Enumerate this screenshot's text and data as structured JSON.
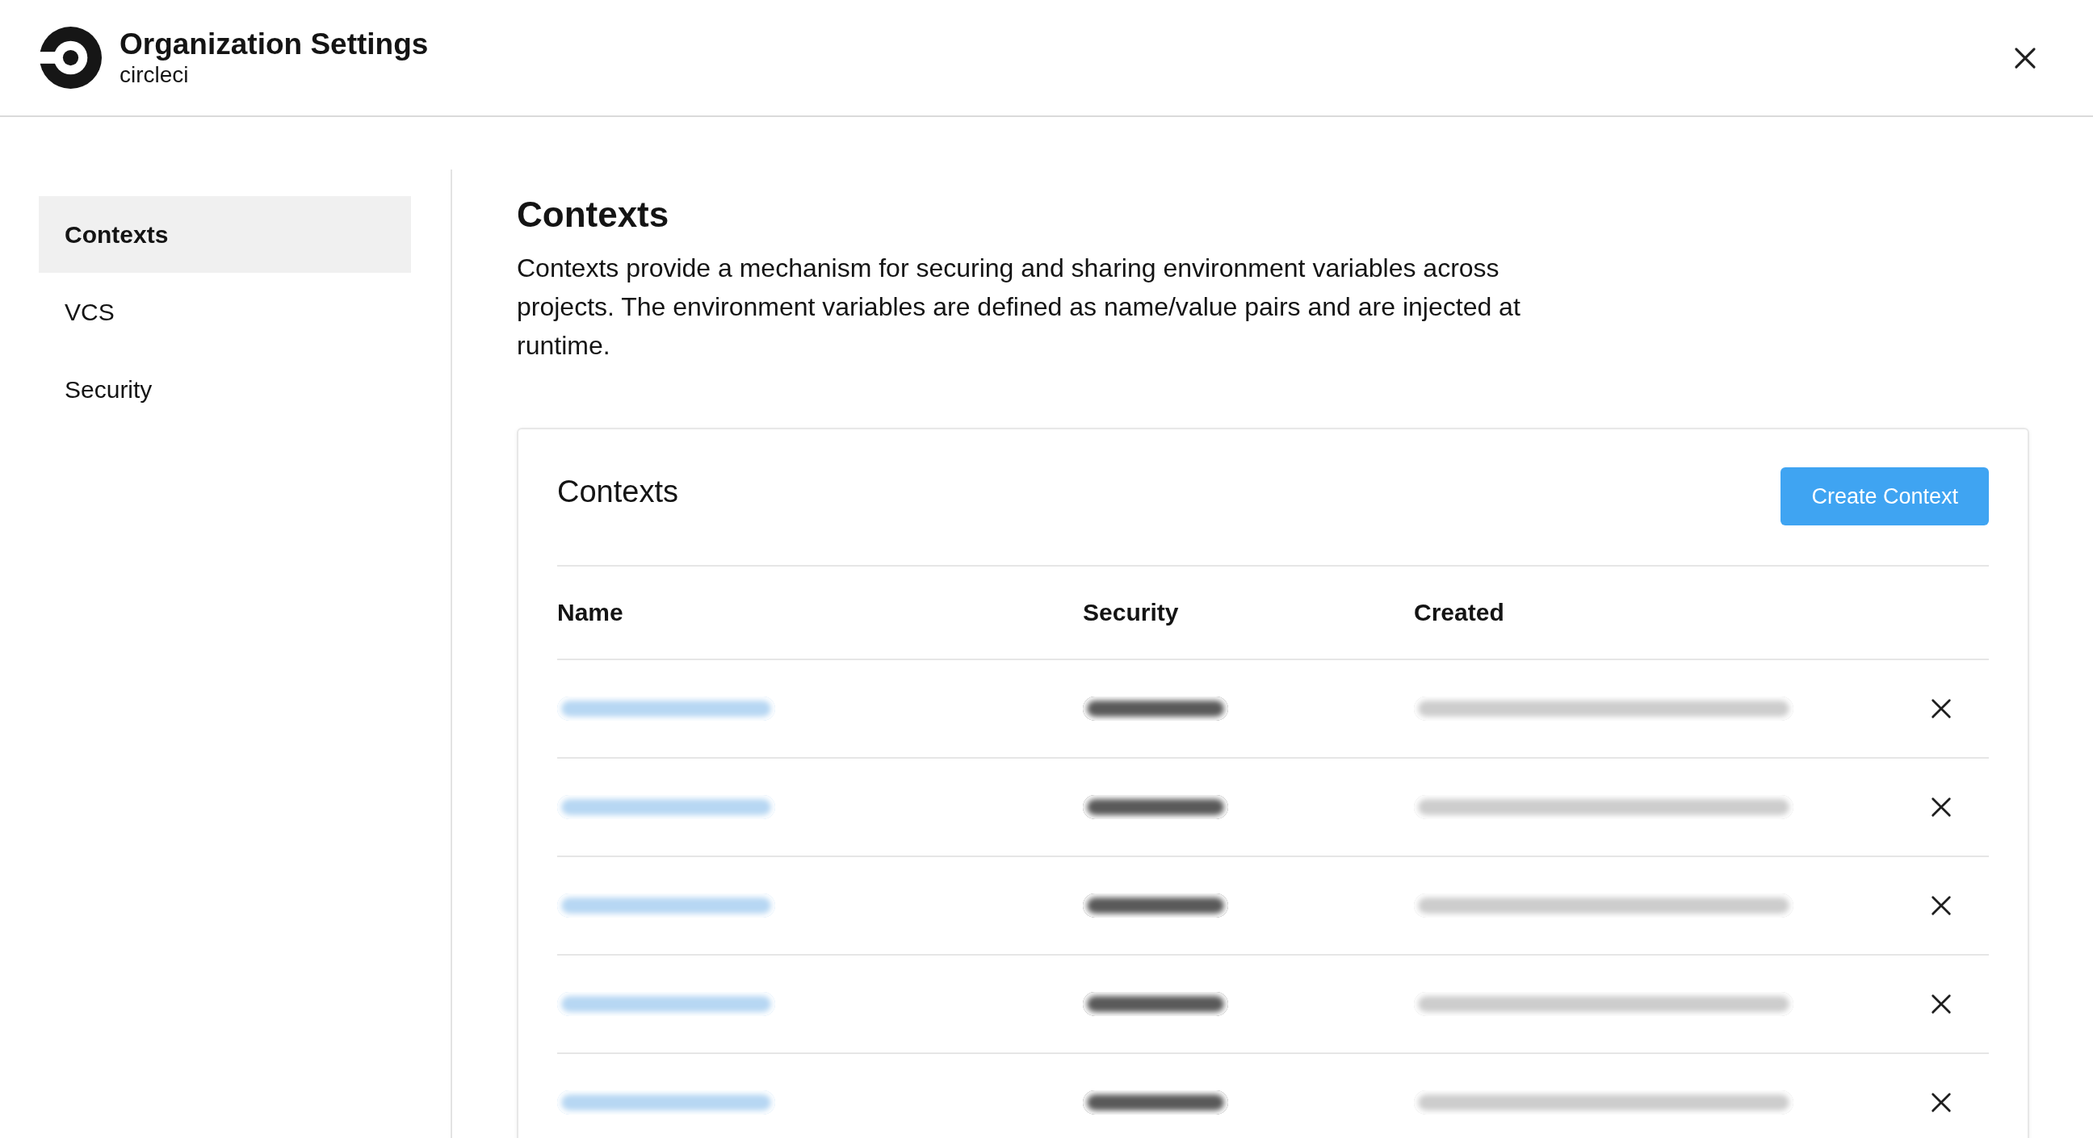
{
  "header": {
    "title": "Organization Settings",
    "subtitle": "circleci"
  },
  "sidebar": {
    "items": [
      {
        "label": "Contexts",
        "selected": true
      },
      {
        "label": "VCS",
        "selected": false
      },
      {
        "label": "Security",
        "selected": false
      }
    ]
  },
  "main": {
    "title": "Contexts",
    "description": "Contexts provide a mechanism for securing and sharing environment variables across projects. The environment variables are defined as name/value pairs and are injected at runtime."
  },
  "card": {
    "title": "Contexts",
    "button": "Create Context",
    "table": {
      "columns": [
        "Name",
        "Security",
        "Created"
      ],
      "rows": [
        {
          "redacted": true
        },
        {
          "redacted": true
        },
        {
          "redacted": true
        },
        {
          "redacted": true
        },
        {
          "redacted": true
        }
      ]
    }
  }
}
